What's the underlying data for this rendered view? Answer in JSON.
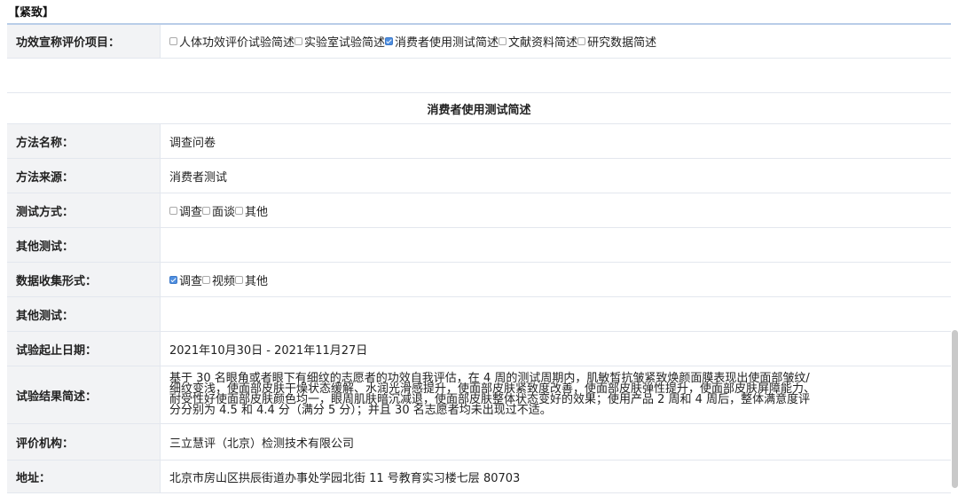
{
  "section_title": "【紧致】",
  "claim": {
    "label": "功效宣称评价项目：",
    "options": [
      {
        "label": "人体功效评价试验简述",
        "checked": false
      },
      {
        "label": "实验室试验简述",
        "checked": false
      },
      {
        "label": "消费者使用测试简述",
        "checked": true
      },
      {
        "label": "文献资料简述",
        "checked": false
      },
      {
        "label": "研究数据简述",
        "checked": false
      }
    ]
  },
  "subheading": "消费者使用测试简述",
  "method_name": {
    "label": "方法名称：",
    "value": "调查问卷"
  },
  "method_source": {
    "label": "方法来源：",
    "value": "消费者测试"
  },
  "test_mode": {
    "label": "测试方式：",
    "options": [
      {
        "label": "调查",
        "checked": false
      },
      {
        "label": "面谈",
        "checked": false
      },
      {
        "label": "其他",
        "checked": false
      }
    ]
  },
  "other_test_1": {
    "label": "其他测试：",
    "value": ""
  },
  "data_collection": {
    "label": "数据收集形式：",
    "options": [
      {
        "label": "调查",
        "checked": true
      },
      {
        "label": "视频",
        "checked": false
      },
      {
        "label": "其他",
        "checked": false
      }
    ]
  },
  "other_test_2": {
    "label": "其他测试：",
    "value": ""
  },
  "date_range": {
    "label": "试验起止日期：",
    "value": "2021年10月30日 - 2021年11月27日"
  },
  "result": {
    "label": "试验结果简述：",
    "value": "基于 30 名眼角或者眼下有细纹的志愿者的功效自我评估，在 4 周的测试周期内，肌敏皙抗皱紧致焕颜面膜表现出使面部皱纹/细纹变浅，使面部皮肤干燥状态缓解、水润光滑感提升，使面部皮肤紧致度改善，使面部皮肤弹性提升，使面部皮肤屏障能力、耐受性好使面部皮肤颜色均一，眼周肌肤暗沉减退，使面部皮肤整体状态变好的效果；使用产品 2 周和 4 周后，整体满意度评分分别为 4.5 和 4.4 分（满分 5 分）；并且 30 名志愿者均未出现过不适。"
  },
  "institution": {
    "label": "评价机构：",
    "value": "三立慧评（北京）检测技术有限公司"
  },
  "address": {
    "label": "地址：",
    "value": "北京市房山区拱辰街道办事处学园北街 11 号教育实习楼七层 80703"
  },
  "colors": {
    "label_bg": "#f2f3f5",
    "checkbox_checked": "#4f8fe0",
    "border_top": "#b9cde8"
  }
}
